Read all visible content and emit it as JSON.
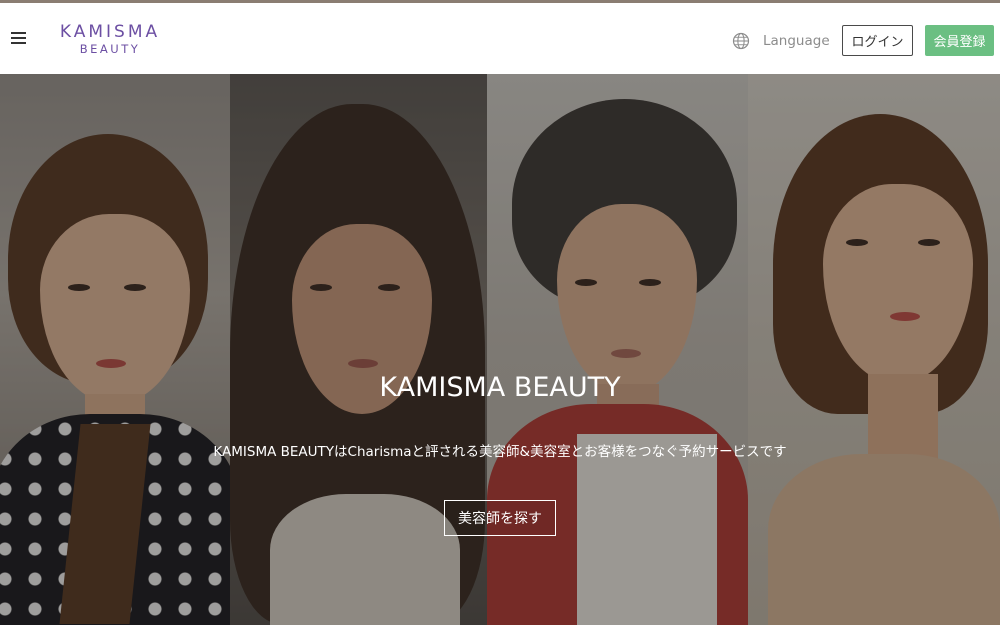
{
  "header": {
    "logo_line1": "KAMISMA",
    "logo_line2": "BEAUTY",
    "language_label": "Language",
    "login_label": "ログイン",
    "signup_label": "会員登録"
  },
  "hero": {
    "title": "KAMISMA BEAUTY",
    "subtitle": "KAMISMA BEAUTYはCharismaと評される美容師&美容室とお客様をつなぐ予約サービスです",
    "cta_label": "美容師を探す"
  },
  "icons": {
    "menu": "hamburger-menu-icon",
    "language": "globe-icon"
  },
  "colors": {
    "brand_purple": "#6c4fa3",
    "signup_green": "#6bbf82",
    "top_strip": "#8a7d72"
  }
}
